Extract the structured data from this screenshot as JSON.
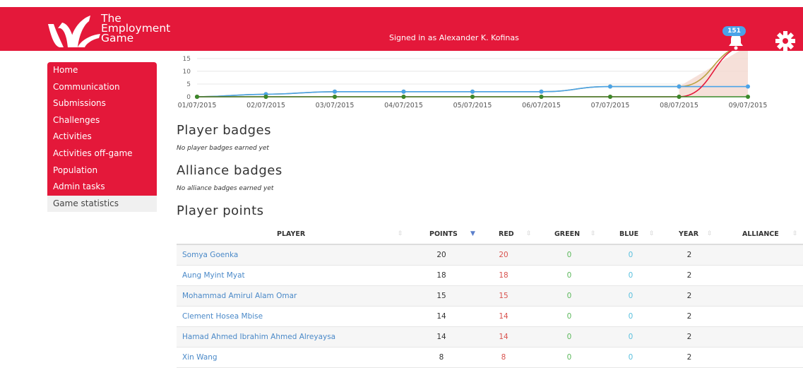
{
  "header": {
    "logo_lines": [
      "The",
      "Employment",
      "Game"
    ],
    "signed_in": "Signed in as Alexander K. Kofinas",
    "notification_count": "151",
    "colors": {
      "brand": "#e4183a",
      "badge": "#4aa3e8"
    }
  },
  "sidebar": {
    "items": [
      {
        "label": "Home"
      },
      {
        "label": "Communication"
      },
      {
        "label": "Submissions"
      },
      {
        "label": "Challenges"
      },
      {
        "label": "Activities"
      },
      {
        "label": "Activities off-game"
      },
      {
        "label": "Population"
      },
      {
        "label": "Admin tasks"
      },
      {
        "label": "Game statistics"
      }
    ]
  },
  "chart_data": {
    "type": "line",
    "x": [
      "01/07/2015",
      "02/07/2015",
      "03/07/2015",
      "04/07/2015",
      "05/07/2015",
      "06/07/2015",
      "07/07/2015",
      "08/07/2015",
      "09/07/2015"
    ],
    "yticks": [
      0,
      5,
      10,
      15
    ],
    "ylim": [
      0,
      18
    ],
    "series": [
      {
        "color": "#b8a040",
        "values": [
          0,
          1,
          2,
          2,
          2,
          2,
          4,
          4,
          20
        ]
      },
      {
        "color": "#4aa3e8",
        "values": [
          0,
          1,
          2,
          2,
          2,
          2,
          4,
          4,
          4
        ]
      },
      {
        "color": "#e4183a",
        "values": [
          0,
          0,
          0,
          0,
          0,
          0,
          0,
          0,
          20
        ]
      },
      {
        "color": "#3a8a2a",
        "values": [
          0,
          0,
          0,
          0,
          0,
          0,
          0,
          0,
          0
        ]
      }
    ]
  },
  "sections": {
    "player_badges_title": "Player badges",
    "player_badges_note": "No player badges earned yet",
    "alliance_badges_title": "Alliance badges",
    "alliance_badges_note": "No alliance badges earned yet",
    "player_points_title": "Player points"
  },
  "table": {
    "headers": {
      "player": "PLAYER",
      "points": "POINTS",
      "red": "RED",
      "green": "GREEN",
      "blue": "BLUE",
      "year": "YEAR",
      "alliance": "ALLIANCE"
    },
    "rows": [
      {
        "player": "Somya Goenka",
        "points": "20",
        "red": "20",
        "green": "0",
        "blue": "0",
        "year": "2",
        "alliance": ""
      },
      {
        "player": "Aung Myint Myat",
        "points": "18",
        "red": "18",
        "green": "0",
        "blue": "0",
        "year": "2",
        "alliance": ""
      },
      {
        "player": "Mohammad Amirul Alam Omar",
        "points": "15",
        "red": "15",
        "green": "0",
        "blue": "0",
        "year": "2",
        "alliance": ""
      },
      {
        "player": "Clement Hosea Mbise",
        "points": "14",
        "red": "14",
        "green": "0",
        "blue": "0",
        "year": "2",
        "alliance": ""
      },
      {
        "player": "Hamad Ahmed Ibrahim Ahmed Alreyaysa",
        "points": "14",
        "red": "14",
        "green": "0",
        "blue": "0",
        "year": "2",
        "alliance": ""
      },
      {
        "player": "Xin Wang",
        "points": "8",
        "red": "8",
        "green": "0",
        "blue": "0",
        "year": "2",
        "alliance": ""
      }
    ]
  }
}
